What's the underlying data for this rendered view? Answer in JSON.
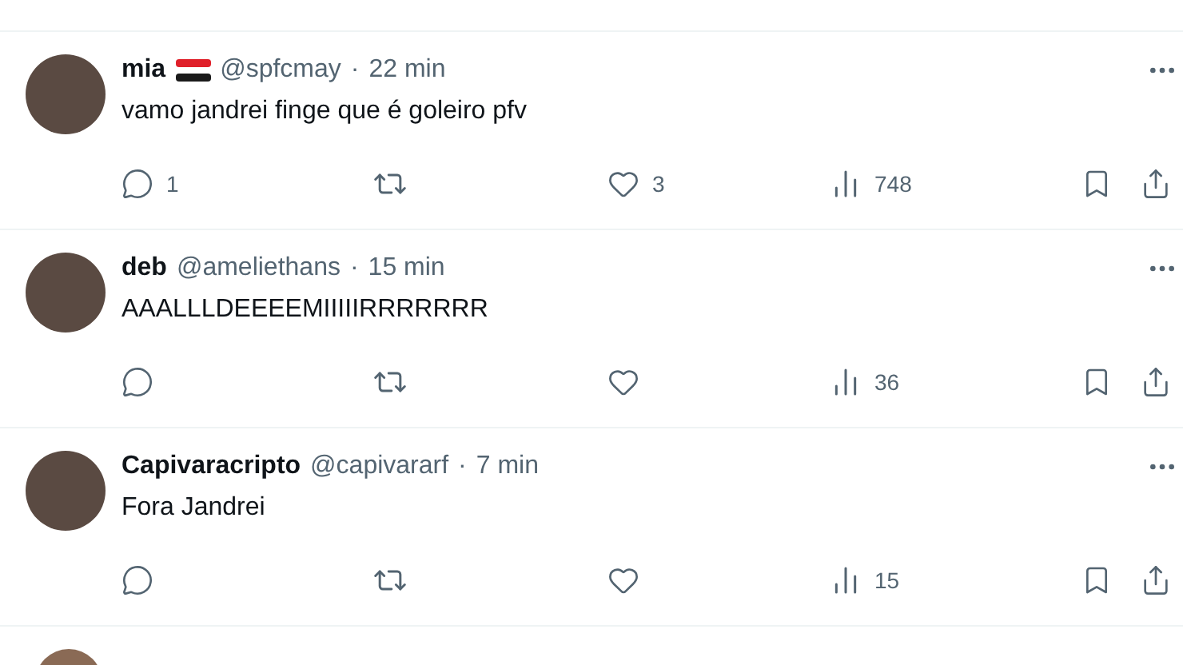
{
  "replies": [
    {
      "name": "mia",
      "flag": true,
      "handle": "@spfcmay",
      "separator": "·",
      "time": "22 min",
      "text": "vamo jandrei finge que é goleiro pfv",
      "replies": "1",
      "likes": "3",
      "views": "748"
    },
    {
      "name": "deb",
      "flag": false,
      "handle": "@ameliethans",
      "separator": "·",
      "time": "15 min",
      "text": "AAALLLDEEEEMIIIIIRRRRRRR",
      "views": "36"
    },
    {
      "name": "Capivaracripto",
      "flag": false,
      "handle": "@capivararf",
      "separator": "·",
      "time": "7 min",
      "text": "Fora Jandrei",
      "views": "15"
    }
  ]
}
